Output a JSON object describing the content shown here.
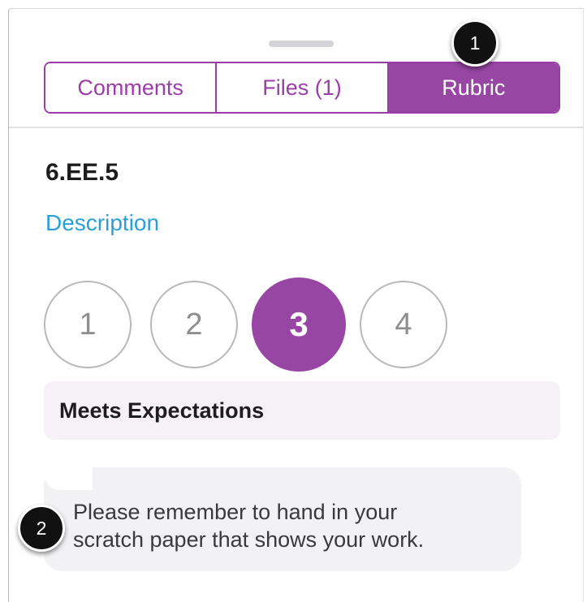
{
  "tabs": [
    {
      "label": "Comments",
      "active": false
    },
    {
      "label": "Files (1)",
      "active": false
    },
    {
      "label": "Rubric",
      "active": true
    }
  ],
  "callouts": {
    "first": "1",
    "second": "2"
  },
  "criterion": {
    "title": "6.EE.5",
    "description_link": "Description",
    "ratings": [
      "1",
      "2",
      "3",
      "4"
    ],
    "selected_rating": "3",
    "selected_rating_label": "Meets Expectations"
  },
  "comment": {
    "lines": [
      "Please remember to hand in your",
      "scratch paper that shows your work."
    ]
  },
  "colors": {
    "accent": "#9747a3",
    "link": "#2a9fd8",
    "rating_box_bg": "#f6f1f7",
    "comment_bg": "#f2f2f4"
  }
}
